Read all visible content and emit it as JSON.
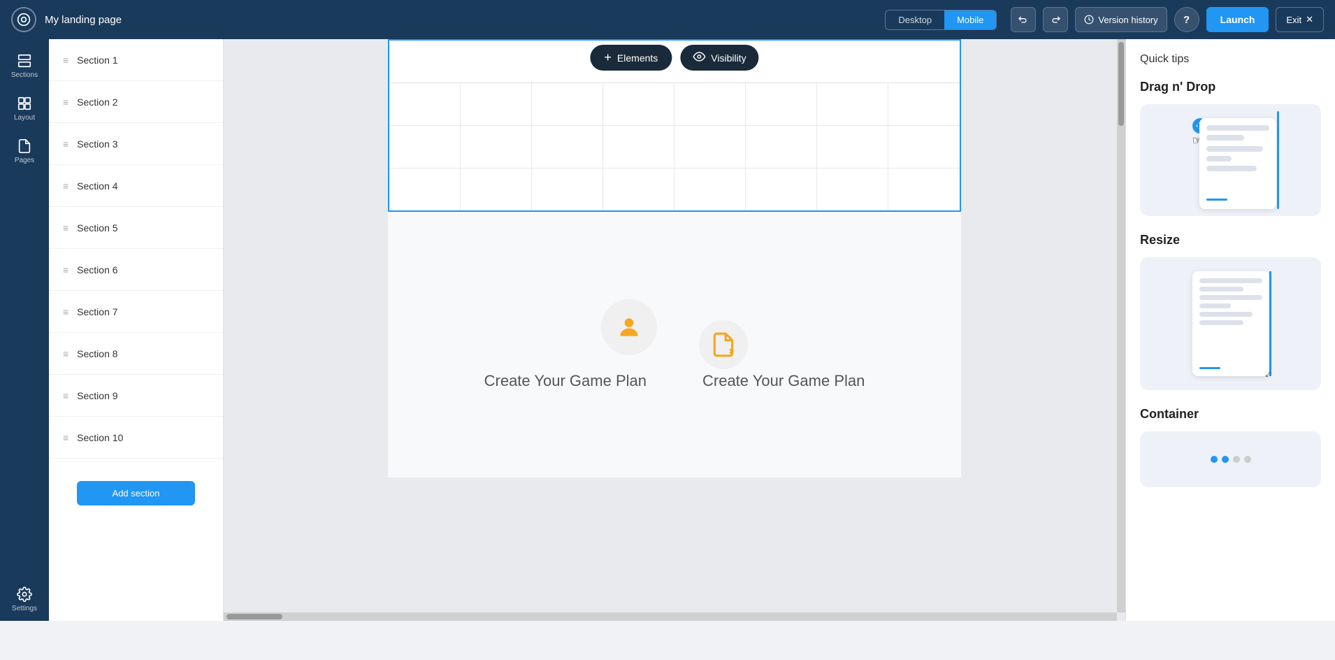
{
  "header": {
    "logo_alt": "App logo",
    "title": "My landing page",
    "view_desktop": "Desktop",
    "view_mobile": "Mobile",
    "active_view": "Mobile",
    "undo_label": "Undo",
    "redo_label": "Redo",
    "version_history_label": "Version history",
    "help_label": "Help",
    "launch_label": "Launch",
    "exit_label": "Exit"
  },
  "sidebar": {
    "sections_label": "Sections",
    "layout_label": "Layout",
    "pages_label": "Pages",
    "settings_label": "Settings"
  },
  "sections_list": {
    "items": [
      {
        "id": 1,
        "label": "Section 1"
      },
      {
        "id": 2,
        "label": "Section 2"
      },
      {
        "id": 3,
        "label": "Section 3"
      },
      {
        "id": 4,
        "label": "Section 4"
      },
      {
        "id": 5,
        "label": "Section 5"
      },
      {
        "id": 6,
        "label": "Section 6"
      },
      {
        "id": 7,
        "label": "Section 7"
      },
      {
        "id": 8,
        "label": "Section 8"
      },
      {
        "id": 9,
        "label": "Section 9"
      },
      {
        "id": 10,
        "label": "Section 10"
      }
    ],
    "add_button_label": "Add section"
  },
  "canvas": {
    "section1": {
      "elements_btn": "Elements",
      "visibility_btn": "Visibility"
    },
    "section2": {
      "game_plan_left": "Create Your Game Plan",
      "game_plan_right": "Create Your Game Plan"
    }
  },
  "tips_panel": {
    "title": "Quick tips",
    "drag_drop": {
      "heading": "Drag n' Drop"
    },
    "resize": {
      "heading": "Resize"
    },
    "container": {
      "heading": "Container"
    }
  },
  "colors": {
    "primary_blue": "#2196f3",
    "dark_navy": "#1a3a5c",
    "orange_accent": "#f5a623",
    "selected_border": "#2196f3"
  }
}
